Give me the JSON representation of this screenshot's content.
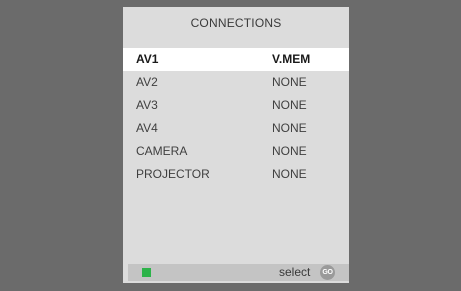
{
  "menu": {
    "title": "CONNECTIONS",
    "items": [
      {
        "name": "AV1",
        "value": "V.MEM"
      },
      {
        "name": "AV2",
        "value": "NONE"
      },
      {
        "name": "AV3",
        "value": "NONE"
      },
      {
        "name": "AV4",
        "value": "NONE"
      },
      {
        "name": "CAMERA",
        "value": "NONE"
      },
      {
        "name": "PROJECTOR",
        "value": "NONE"
      }
    ],
    "selected_index": 0
  },
  "footer": {
    "select_label": "select",
    "go_label": "GO",
    "green_key_color": "#2db34a"
  },
  "colors": {
    "background": "#6b6b6b",
    "panel": "#dcdcdc",
    "highlight": "#ffffff"
  }
}
